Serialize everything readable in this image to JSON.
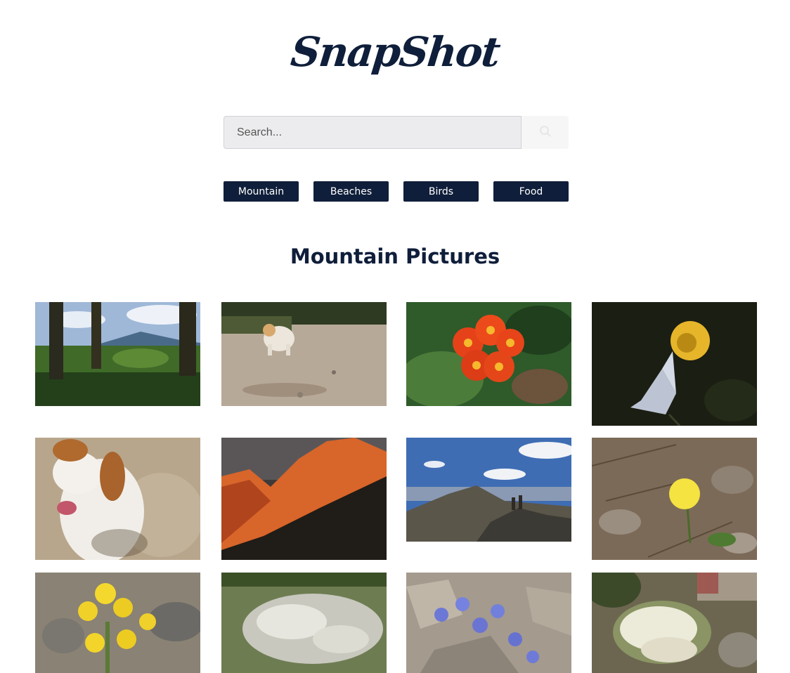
{
  "brand": {
    "logo_text": "SnapShot"
  },
  "search": {
    "placeholder": "Search...",
    "value": "",
    "icon": "search-icon"
  },
  "categories": [
    "Mountain",
    "Beaches",
    "Birds",
    "Food"
  ],
  "gallery": {
    "title": "Mountain Pictures",
    "photos": [
      {
        "subject": "forest-trees-mountain-view"
      },
      {
        "subject": "small-white-dog-on-dirt"
      },
      {
        "subject": "orange-hawkweed-flower"
      },
      {
        "subject": "yellow-flower-dark-background"
      },
      {
        "subject": "spaniel-dog-closeup"
      },
      {
        "subject": "sunlit-mountain-ridge"
      },
      {
        "subject": "hikers-on-summit"
      },
      {
        "subject": "yellow-flower-pine-needles"
      },
      {
        "subject": "yellow-wildflowers-rocks"
      },
      {
        "subject": "white-alpine-flowers"
      },
      {
        "subject": "purple-flowers-rocks"
      },
      {
        "subject": "white-flowers-rocky-slope"
      }
    ]
  },
  "colors": {
    "brand": "#0f1e3a",
    "search_bg": "#ececee"
  }
}
